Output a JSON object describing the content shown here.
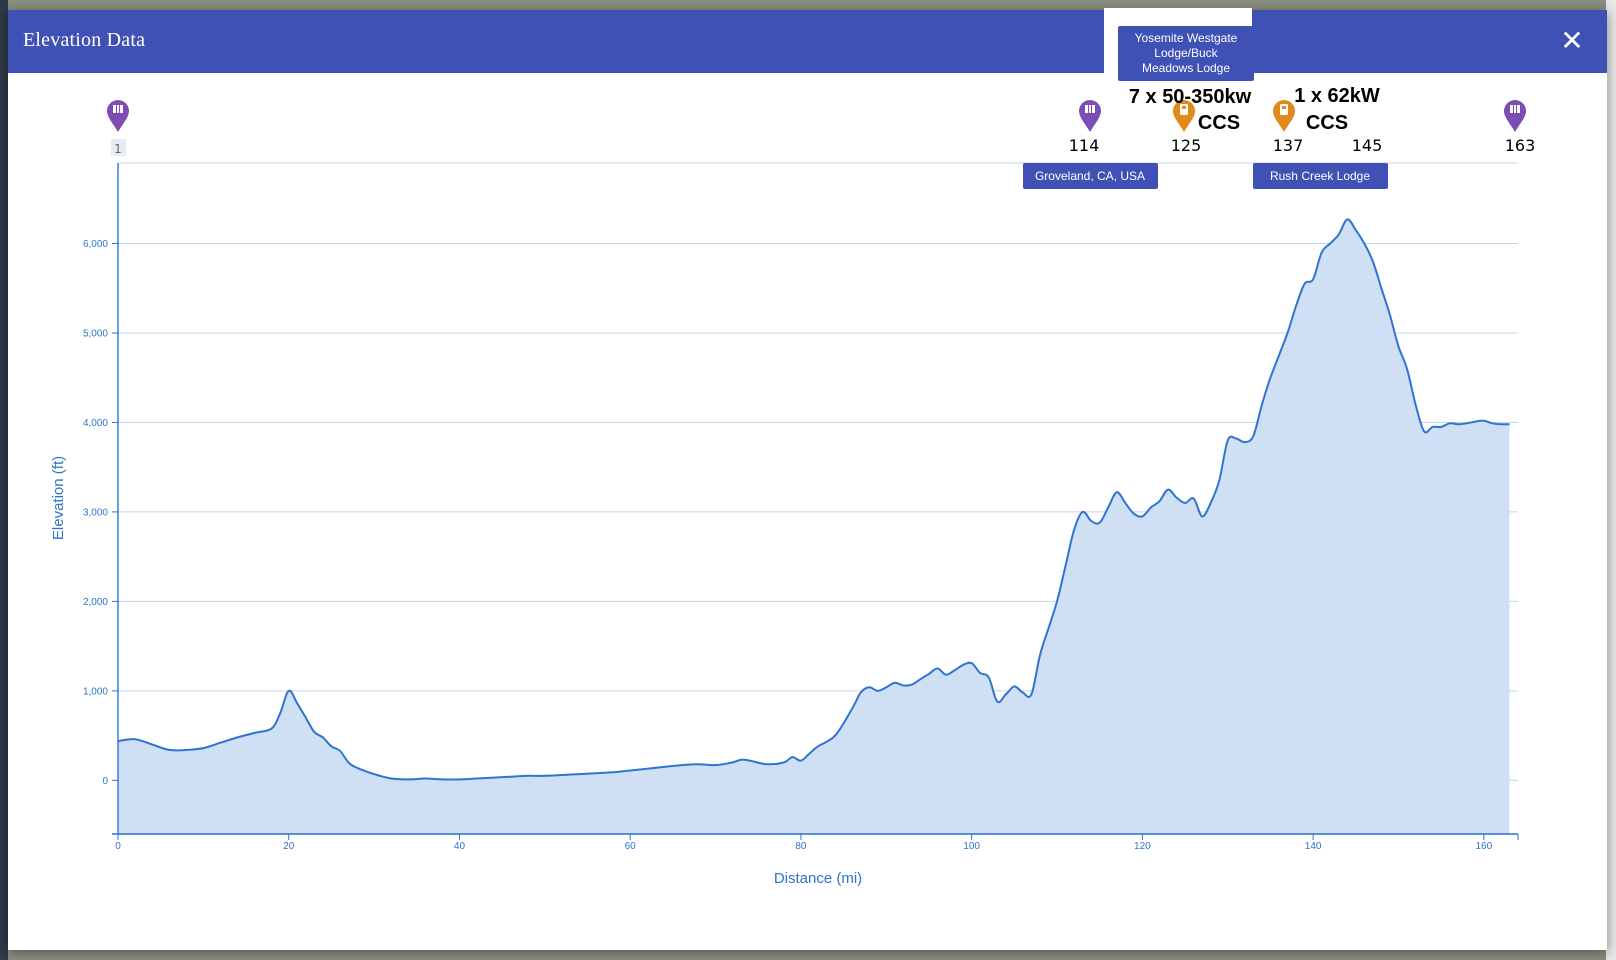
{
  "modal": {
    "title": "Elevation Data",
    "close_label": "✕"
  },
  "markers": [
    {
      "label": "1",
      "icon": "map-pin-icon",
      "color": "#7b4db5"
    },
    {
      "label": "114",
      "icon": "map-pin-icon",
      "color": "#7b4db5"
    },
    {
      "label": "125",
      "icon": "charger-pin-icon",
      "color": "#e08a1e"
    },
    {
      "label": "137",
      "icon": "charger-pin-icon",
      "color": "#e08a1e"
    },
    {
      "label": "145",
      "icon": "",
      "color": ""
    },
    {
      "label": "163",
      "icon": "map-pin-icon",
      "color": "#7b4db5"
    }
  ],
  "place_labels": [
    {
      "text": "Groveland, CA, USA"
    },
    {
      "lines": [
        "Yosemite Westgate",
        "Lodge/Buck",
        "Meadows Lodge"
      ]
    },
    {
      "text": "Rush Creek Lodge"
    }
  ],
  "station_info": [
    {
      "lines": [
        "7 x 50-350kw",
        "CCS"
      ]
    },
    {
      "lines": [
        "1 x 62kW",
        "CCS"
      ]
    }
  ],
  "colors": {
    "header": "#3f51b5",
    "line": "#2f74cf",
    "fill": "#cfe0f4",
    "label_box": "#3f51b5"
  },
  "chart_data": {
    "type": "area",
    "title": "",
    "xlabel": "Distance (mi)",
    "ylabel": "Elevation (ft)",
    "xlim": [
      0,
      164
    ],
    "ylim": [
      -600,
      6900
    ],
    "x_ticks": [
      0,
      20,
      40,
      60,
      80,
      100,
      120,
      140,
      160
    ],
    "x_tick_labels": [
      "0",
      "20",
      "40",
      "60",
      "80",
      "100",
      "120",
      "140",
      "160"
    ],
    "y_ticks": [
      0,
      1000,
      2000,
      3000,
      4000,
      5000,
      6000
    ],
    "y_tick_labels": [
      "0",
      "1,000",
      "2,000",
      "3,000",
      "4,000",
      "5,000",
      "6,000"
    ],
    "grid": true,
    "series": [
      {
        "x": [
          0,
          2,
          4,
          6,
          8,
          10,
          12,
          14,
          16,
          18,
          19,
          20,
          21,
          22,
          23,
          24,
          25,
          26,
          27,
          28,
          30,
          32,
          34,
          36,
          38,
          40,
          42,
          44,
          46,
          48,
          50,
          52,
          54,
          56,
          58,
          60,
          62,
          64,
          66,
          68,
          70,
          72,
          73,
          74,
          76,
          78,
          79,
          80,
          81,
          82,
          84,
          86,
          87,
          88,
          89,
          90,
          91,
          92,
          93,
          94,
          95,
          96,
          97,
          98,
          99,
          100,
          101,
          102,
          103,
          104,
          105,
          106,
          107,
          108,
          109,
          110,
          111,
          112,
          113,
          114,
          115,
          116,
          117,
          118,
          119,
          120,
          121,
          122,
          123,
          124,
          125,
          126,
          127,
          128,
          129,
          130,
          131,
          132,
          133,
          134,
          135,
          136,
          137,
          138,
          139,
          140,
          141,
          142,
          143,
          144,
          145,
          146,
          147,
          148,
          149,
          150,
          151,
          152,
          153,
          154,
          155,
          156,
          157,
          158,
          159,
          160,
          161,
          162,
          163
        ],
        "y": [
          440,
          460,
          400,
          340,
          340,
          360,
          420,
          480,
          530,
          580,
          750,
          1000,
          860,
          700,
          540,
          480,
          380,
          330,
          200,
          140,
          70,
          20,
          10,
          20,
          10,
          10,
          20,
          30,
          40,
          50,
          50,
          60,
          70,
          80,
          90,
          110,
          130,
          150,
          170,
          180,
          170,
          200,
          230,
          220,
          180,
          200,
          260,
          220,
          300,
          380,
          500,
          800,
          980,
          1040,
          1000,
          1040,
          1090,
          1060,
          1070,
          1130,
          1190,
          1250,
          1180,
          1230,
          1290,
          1310,
          1200,
          1150,
          880,
          960,
          1050,
          980,
          960,
          1400,
          1700,
          2000,
          2400,
          2800,
          3000,
          2900,
          2880,
          3050,
          3220,
          3100,
          2980,
          2950,
          3050,
          3120,
          3250,
          3160,
          3100,
          3150,
          2950,
          3100,
          3350,
          3800,
          3820,
          3780,
          3850,
          4200,
          4500,
          4750,
          5000,
          5300,
          5550,
          5600,
          5900,
          6000,
          6100,
          6270,
          6150,
          6000,
          5800,
          5500,
          5200,
          4850,
          4600,
          4200,
          3900,
          3950,
          3950,
          3990,
          3980,
          3990,
          4010,
          4020,
          3990,
          3980,
          3980
        ]
      }
    ]
  }
}
